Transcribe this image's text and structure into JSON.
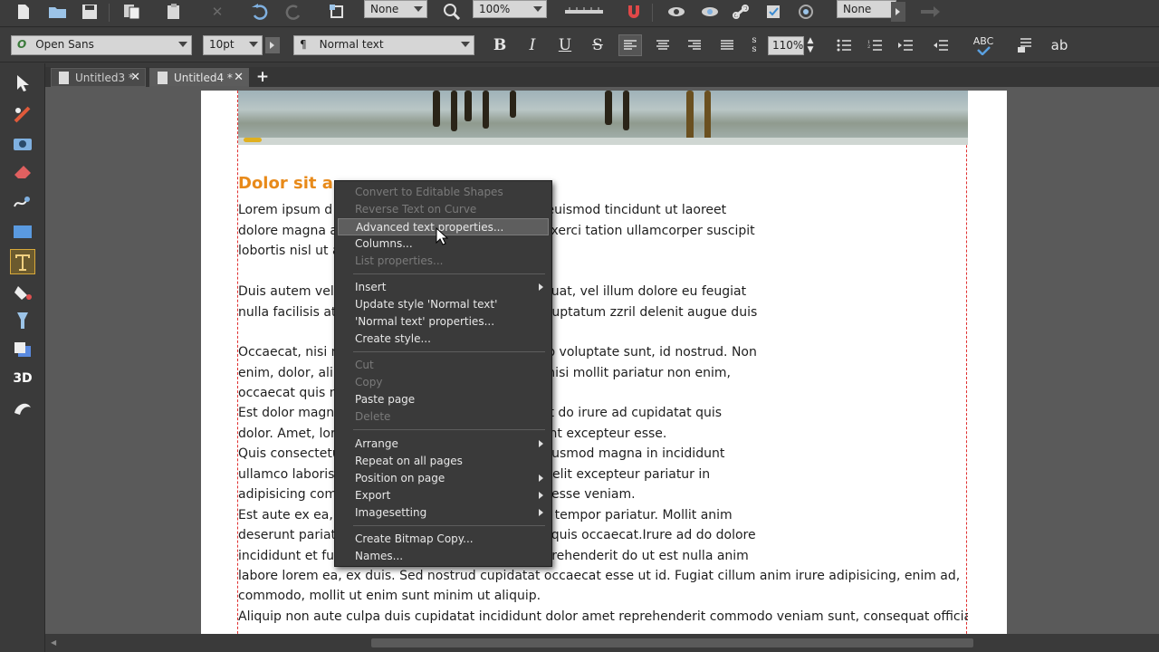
{
  "toolbar": {
    "line_style_value": "None",
    "zoom_value": "100%",
    "shadow_value": "None"
  },
  "format_bar": {
    "font_name": "Open Sans",
    "font_size": "10pt",
    "style_name": "Normal text",
    "zoom_text": "110%",
    "bold": "B",
    "italic": "I",
    "underline": "U",
    "strike": "S",
    "spell": "ABC",
    "ab": "ab"
  },
  "tabs": [
    {
      "label": "Untitled3 *"
    },
    {
      "label": "Untitled4 *"
    }
  ],
  "document": {
    "heading": "Dolor sit a",
    "paragraphs": [
      {
        "text": "Lorem ipsum d                                                                  ng elit, sed diam nonummy nibh euismod tincidunt ut laoreet"
      },
      {
        "text": "dolore magna a                                                                  ad minim veniam, quis nostrud exerci tation ullamcorper suscipit"
      },
      {
        "text": "lobortis nisl ut a"
      },
      {
        "text": "Duis autem vel                                                                  putate velit esse molestie consequat, vel illum dolore eu feugiat"
      },
      {
        "text": "nulla facilisis at                                                                  o dignissim qui blandit praesent luptatum zzril delenit augue duis"
      },
      {
        "text": "Occaecat, nisi n                                                                  ut voluptate, commodo ut aliquip voluptate sunt, id nostrud. Non"
      },
      {
        "text": "enim, dolor, ali                                                                  ris dolor. Dolor commodo aliquip nisi mollit pariatur non enim,"
      },
      {
        "text": "occaecat quis n                                                                  ı eiusmod."
      },
      {
        "text": "Est dolor magn                                                                  gna duis, incididunt reprehenderit do irure ad cupidatat quis"
      },
      {
        "text": "dolor. Amet, lor                                                                  teur, duis adipisicing elit incididunt excepteur esse."
      },
      {
        "text": "Quis consectetu                                                                  velit est veniam in. Fugiat, qui eiusmod magna in incididunt"
      },
      {
        "text": "ullamco laboris                                                                  Adipisicing nostrud aliquip officia elit excepteur pariatur in"
      },
      {
        "text": "adipisicing com                                                                  enim esse aute consectetur duis esse veniam."
      },
      {
        "text": "Est aute ex ea, a                                                                  . Sunt cupidatat esse dolore elit tempor pariatur. Mollit anim"
      },
      {
        "text": "deserunt pariat                                                                  duis. Magna in reprehenderit elit quis occaecat.Irure ad do dolore"
      },
      {
        "text": "incididunt et fu                                                                  nulla, dolor qui veniam qui sit reprehenderit do ut est nulla anim"
      },
      {
        "text": "labore lorem ea, ex duis. Sed nostrud cupidatat occaecat esse ut id. Fugiat cillum anim irure adipisicing, enim ad,"
      },
      {
        "text": "commodo, mollit ut enim sunt minim ut aliquip."
      },
      {
        "text": "Aliquip non aute culpa duis cupidatat incididunt dolor amet reprehenderit commodo veniam sunt, consequat officia"
      }
    ]
  },
  "context_menu": {
    "items": [
      {
        "label": "Convert to Editable Shapes",
        "disabled": true
      },
      {
        "label": "Reverse Text on Curve",
        "disabled": true
      },
      {
        "label": "Advanced text properties...",
        "highlighted": true
      },
      {
        "label": "Columns..."
      },
      {
        "label": "List properties...",
        "disabled": true
      },
      {
        "label": "Insert",
        "submenu": true
      },
      {
        "label": "Update style 'Normal text'"
      },
      {
        "label": "'Normal text' properties..."
      },
      {
        "label": "Create style..."
      },
      {
        "label": "Cut",
        "disabled": true
      },
      {
        "label": "Copy",
        "disabled": true
      },
      {
        "label": "Paste page"
      },
      {
        "label": "Delete",
        "disabled": true
      },
      {
        "label": "Arrange",
        "submenu": true
      },
      {
        "label": "Repeat on all pages"
      },
      {
        "label": "Position on page",
        "submenu": true
      },
      {
        "label": "Export",
        "submenu": true
      },
      {
        "label": "Imagesetting",
        "submenu": true
      },
      {
        "label": "Create Bitmap Copy..."
      },
      {
        "label": "Names..."
      }
    ]
  },
  "colors": {
    "accent_orange": "#e88a1a",
    "frame_guide": "#e03030",
    "menu_bg": "#3a3a3a",
    "menu_highlight": "#5e5e5e"
  }
}
